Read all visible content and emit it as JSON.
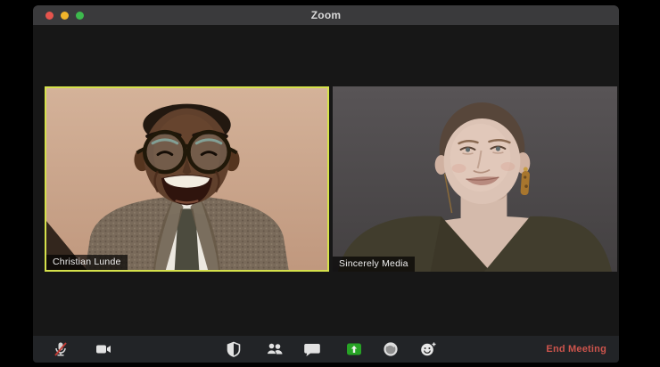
{
  "window": {
    "title": "Zoom",
    "traffic_lights": [
      "close",
      "minimize",
      "fullscreen"
    ]
  },
  "participants": [
    {
      "name": "Christian Lunde",
      "active_speaker": true,
      "video_on": true
    },
    {
      "name": "Sincerely Media",
      "active_speaker": false,
      "video_on": true
    }
  ],
  "toolbar": {
    "buttons": [
      {
        "id": "mute",
        "icon": "microphone-muted-icon",
        "state": "muted"
      },
      {
        "id": "video",
        "icon": "video-camera-icon",
        "state": "on"
      },
      {
        "id": "security",
        "icon": "security-shield-icon"
      },
      {
        "id": "participants",
        "icon": "participants-icon"
      },
      {
        "id": "chat",
        "icon": "chat-bubble-icon"
      },
      {
        "id": "share-screen",
        "icon": "share-screen-icon"
      },
      {
        "id": "record",
        "icon": "record-icon"
      },
      {
        "id": "reactions",
        "icon": "reactions-icon"
      }
    ],
    "end_meeting_label": "End Meeting"
  },
  "colors": {
    "titlebar-bg": "#3a3a3c",
    "window-bg": "#171717",
    "toolbar-bg": "#222427",
    "active-speaker-border": "#d5e14b",
    "end-meeting-red": "#cd544c",
    "share-green": "#27a325",
    "traffic-red": "#e5544d",
    "traffic-yellow": "#f0b42b",
    "traffic-green": "#3db94d",
    "name-label-bg": "rgba(0,0,0,0.68)"
  }
}
